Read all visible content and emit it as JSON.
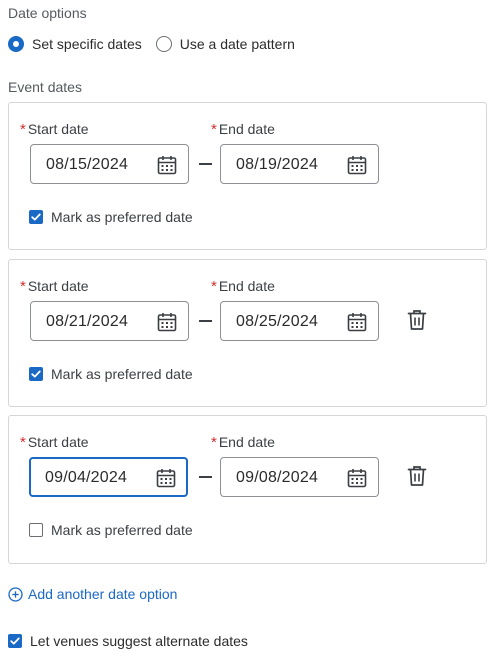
{
  "date_options": {
    "label": "Date options",
    "options": [
      {
        "label": "Set specific dates",
        "selected": true
      },
      {
        "label": "Use a date pattern",
        "selected": false
      }
    ]
  },
  "event_dates": {
    "label": "Event dates",
    "start_label": "Start date",
    "end_label": "End date",
    "required_marker": "*",
    "preferred_label": "Mark as preferred date",
    "rows": [
      {
        "start": "08/15/2024",
        "end": "08/19/2024",
        "preferred": true,
        "deletable": false,
        "focused": false
      },
      {
        "start": "08/21/2024",
        "end": "08/25/2024",
        "preferred": true,
        "deletable": true,
        "focused": false
      },
      {
        "start": "09/04/2024",
        "end": "09/08/2024",
        "preferred": false,
        "deletable": true,
        "focused": true
      }
    ]
  },
  "add_option_label": "Add another date option",
  "suggest_label": "Let venues suggest alternate dates",
  "suggest_checked": true,
  "colors": {
    "accent": "#1a69c4",
    "required": "#d32f2f",
    "border": "#d4d6d9"
  },
  "icons": {
    "calendar": "calendar-icon",
    "delete": "trash-icon",
    "add": "plus-circle-icon",
    "check": "checkmark-icon"
  }
}
